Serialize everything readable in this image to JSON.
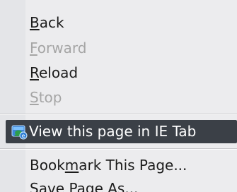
{
  "context_menu": {
    "items": [
      {
        "pre": "",
        "accel": "B",
        "post": "ack",
        "enabled": true
      },
      {
        "pre": "",
        "accel": "F",
        "post": "orward",
        "enabled": false
      },
      {
        "pre": "",
        "accel": "R",
        "post": "eload",
        "enabled": true
      },
      {
        "pre": "",
        "accel": "S",
        "post": "top",
        "enabled": false
      }
    ],
    "ie_tab": {
      "label": "View this page in IE Tab",
      "icon": "ie-tab-icon",
      "highlighted": true
    },
    "bookmark": {
      "pre": "Book",
      "accel": "m",
      "post": "ark This Page..."
    },
    "save_page": {
      "pre": "Save Page ",
      "accel": "A",
      "post": "s..."
    }
  },
  "colors": {
    "menu_background": "#ececee",
    "highlight_background": "#3b4047",
    "highlight_text": "#ffffff",
    "text": "#1b1b1b",
    "disabled_text": "#a5a5a5"
  }
}
